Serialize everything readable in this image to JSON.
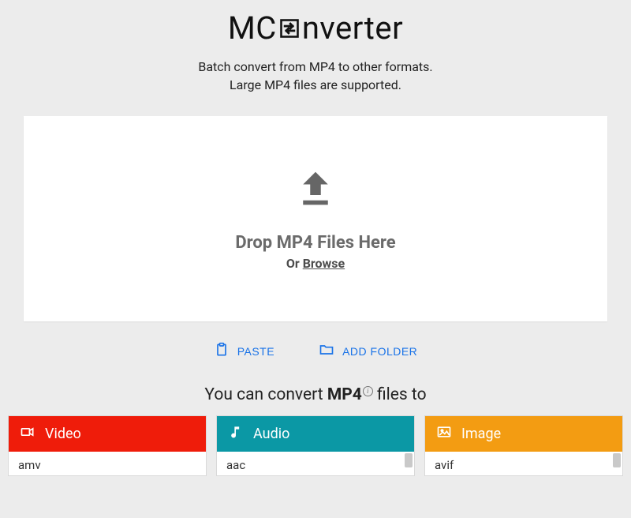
{
  "logo": {
    "prefix": "MC",
    "suffix": "nverter"
  },
  "subtitle": {
    "line1": "Batch convert from MP4 to other formats.",
    "line2": "Large MP4 files are supported."
  },
  "dropzone": {
    "title": "Drop MP4 Files Here",
    "or": "Or ",
    "browse": "Browse"
  },
  "actions": {
    "paste": "PASTE",
    "add_folder": "ADD FOLDER"
  },
  "convert_heading": {
    "pre": "You can convert ",
    "bold": "MP4",
    "post": " files to"
  },
  "cards": {
    "video": {
      "title": "Video",
      "first_item": "amv"
    },
    "audio": {
      "title": "Audio",
      "first_item": "aac"
    },
    "image": {
      "title": "Image",
      "first_item": "avif"
    }
  }
}
